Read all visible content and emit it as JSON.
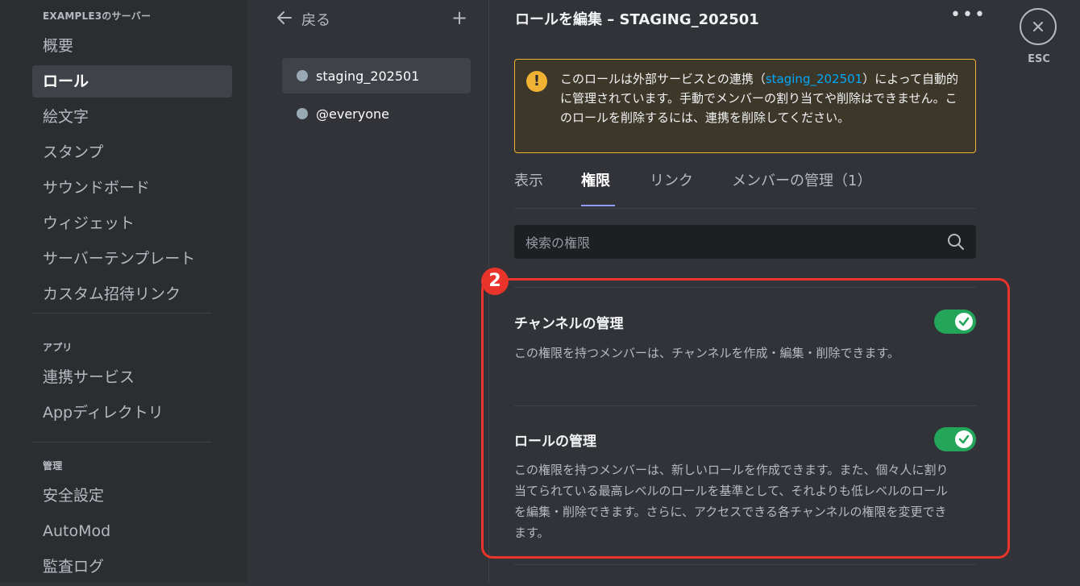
{
  "sidebar": {
    "server_header": "EXAMPLE3のサーバー",
    "server_items": [
      {
        "label": "概要"
      },
      {
        "label": "ロール"
      },
      {
        "label": "絵文字"
      },
      {
        "label": "スタンプ"
      },
      {
        "label": "サウンドボード"
      },
      {
        "label": "ウィジェット"
      },
      {
        "label": "サーバーテンプレート"
      },
      {
        "label": "カスタム招待リンク"
      }
    ],
    "apps_header": "アプリ",
    "apps_items": [
      {
        "label": "連携サービス"
      },
      {
        "label": "Appディレクトリ"
      }
    ],
    "manage_header": "管理",
    "manage_items": [
      {
        "label": "安全設定"
      },
      {
        "label": "AutoMod"
      },
      {
        "label": "監査ログ"
      }
    ]
  },
  "roles": {
    "back_label": "戻る",
    "add_label": "+",
    "items": [
      {
        "label": "staging_202501"
      },
      {
        "label": "@everyone"
      }
    ]
  },
  "editor": {
    "title": "ロールを編集 – STAGING_202501",
    "more_label": "•••",
    "warning": {
      "icon": "!",
      "text_before": "このロールは外部サービスとの連携（",
      "link": "staging_202501",
      "text_after": "）によって自動的に管理されています。手動でメンバーの割り当てや削除はできません。このロールを削除するには、連携を削除してください。"
    },
    "tabs": [
      {
        "label": "表示"
      },
      {
        "label": "権限"
      },
      {
        "label": "リンク"
      },
      {
        "label": "メンバーの管理（1）"
      }
    ],
    "search_placeholder": "検索の権限",
    "badge_number": "2",
    "permissions": [
      {
        "title": "チャンネルの管理",
        "desc": "この権限を持つメンバーは、チャンネルを作成・編集・削除できます。",
        "enabled": true
      },
      {
        "title": "ロールの管理",
        "desc": "この権限を持つメンバーは、新しいロールを作成できます。また、個々人に割り当てられている最高レベルのロールを基準として、それよりも低レベルのロールを編集・削除できます。さらに、アクセスできる各チャンネルの権限を変更できます。",
        "enabled": true
      }
    ]
  },
  "close": {
    "label": "ESC"
  },
  "colors": {
    "accent_tab": "#949cf7",
    "toggle_on": "#23a55a",
    "warning_border": "#f0b232",
    "highlight": "#e8342a",
    "link": "#00a8fc"
  }
}
